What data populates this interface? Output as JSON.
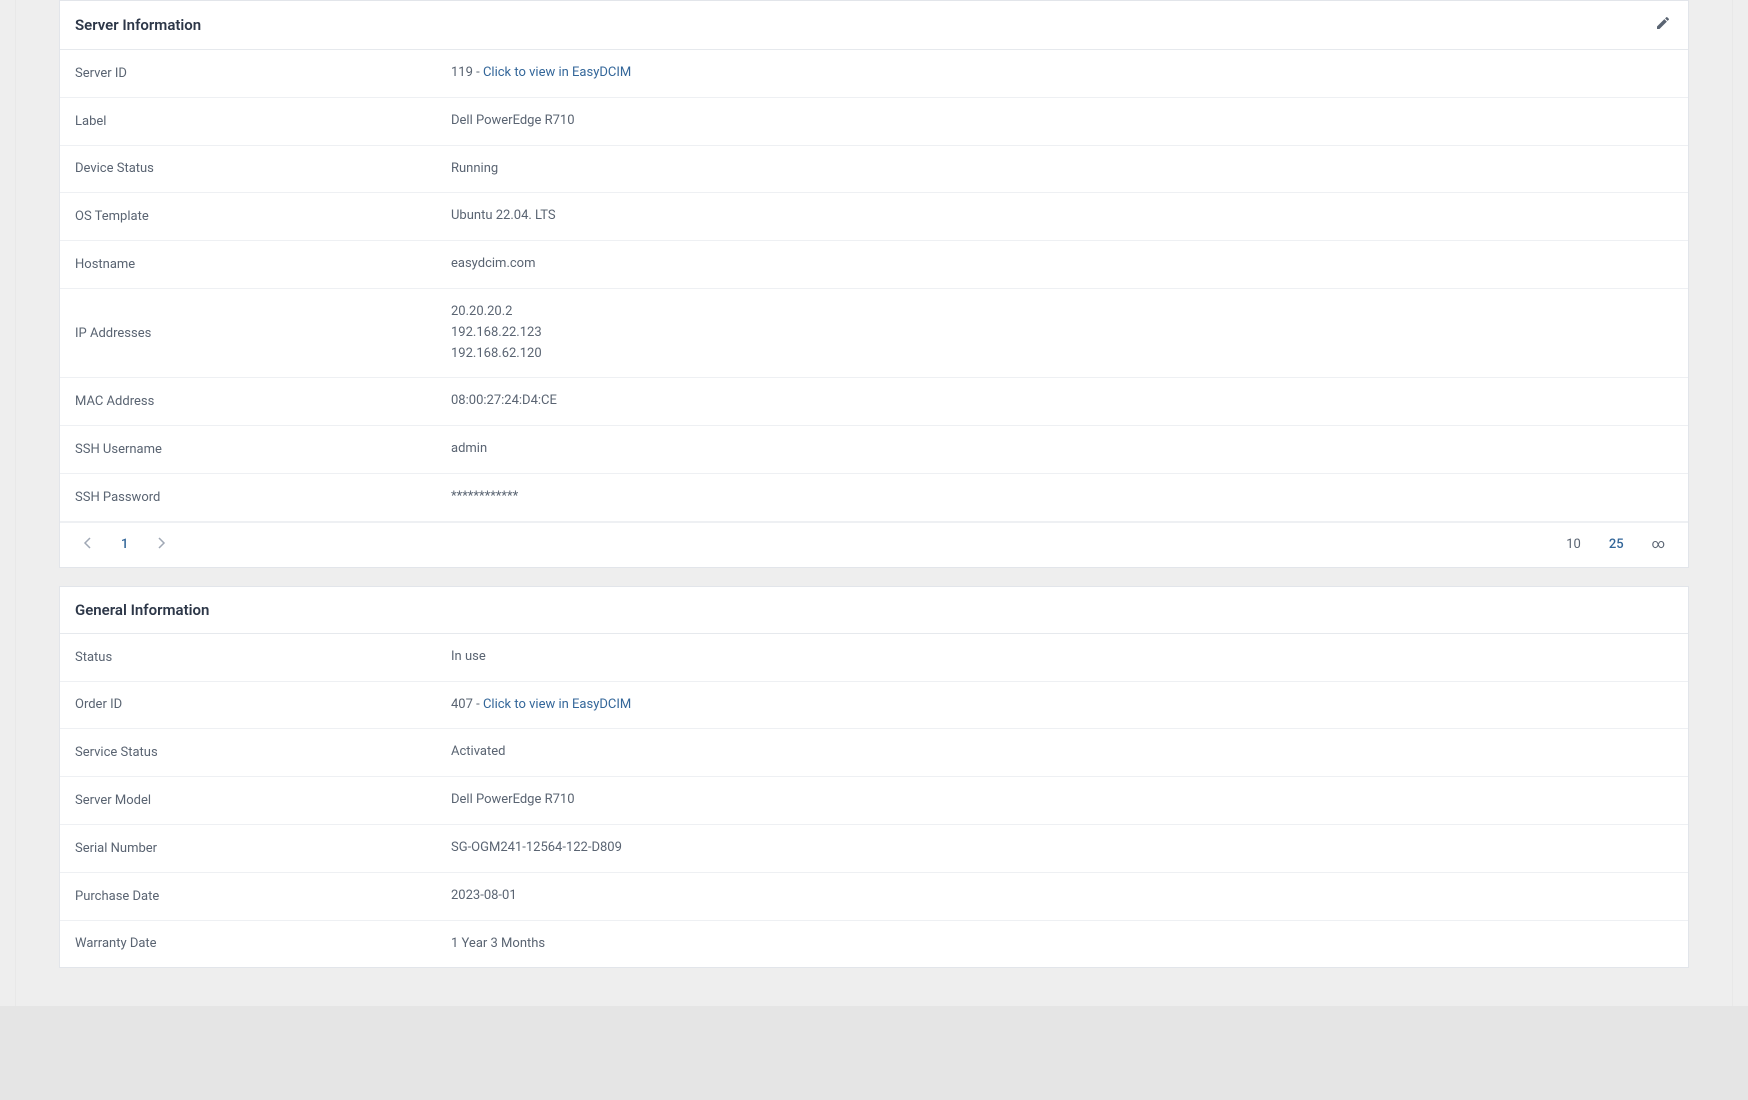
{
  "server_info": {
    "title": "Server Information",
    "rows": {
      "server_id": {
        "label": "Server ID",
        "prefix": "119 - ",
        "link_text": "Click to view in EasyDCIM"
      },
      "label": {
        "label": "Label",
        "value": "Dell PowerEdge R710"
      },
      "device_status": {
        "label": "Device Status",
        "value": "Running"
      },
      "os_template": {
        "label": "OS Template",
        "value": "Ubuntu 22.04. LTS"
      },
      "hostname": {
        "label": "Hostname",
        "value": "easydcim.com"
      },
      "ip_addresses": {
        "label": "IP Addresses",
        "lines": [
          "20.20.20.2",
          "192.168.22.123",
          "192.168.62.120"
        ]
      },
      "mac_address": {
        "label": "MAC Address",
        "value": "08:00:27:24:D4:CE"
      },
      "ssh_username": {
        "label": "SSH Username",
        "value": "admin"
      },
      "ssh_password": {
        "label": "SSH Password",
        "value": "************"
      }
    }
  },
  "pagination": {
    "current_page": "1",
    "size_options": {
      "opt10": "10",
      "opt25": "25",
      "infinity": "∞"
    }
  },
  "general_info": {
    "title": "General Information",
    "rows": {
      "status": {
        "label": "Status",
        "value": "In use"
      },
      "order_id": {
        "label": "Order ID",
        "prefix": "407 - ",
        "link_text": "Click to view in EasyDCIM"
      },
      "service_status": {
        "label": "Service Status",
        "value": "Activated"
      },
      "server_model": {
        "label": "Server Model",
        "value": "Dell PowerEdge R710"
      },
      "serial_number": {
        "label": "Serial Number",
        "value": "SG-OGM241-12564-122-D809"
      },
      "purchase_date": {
        "label": "Purchase Date",
        "value": "2023-08-01"
      },
      "warranty_date": {
        "label": "Warranty Date",
        "value": "1 Year 3 Months"
      }
    }
  }
}
